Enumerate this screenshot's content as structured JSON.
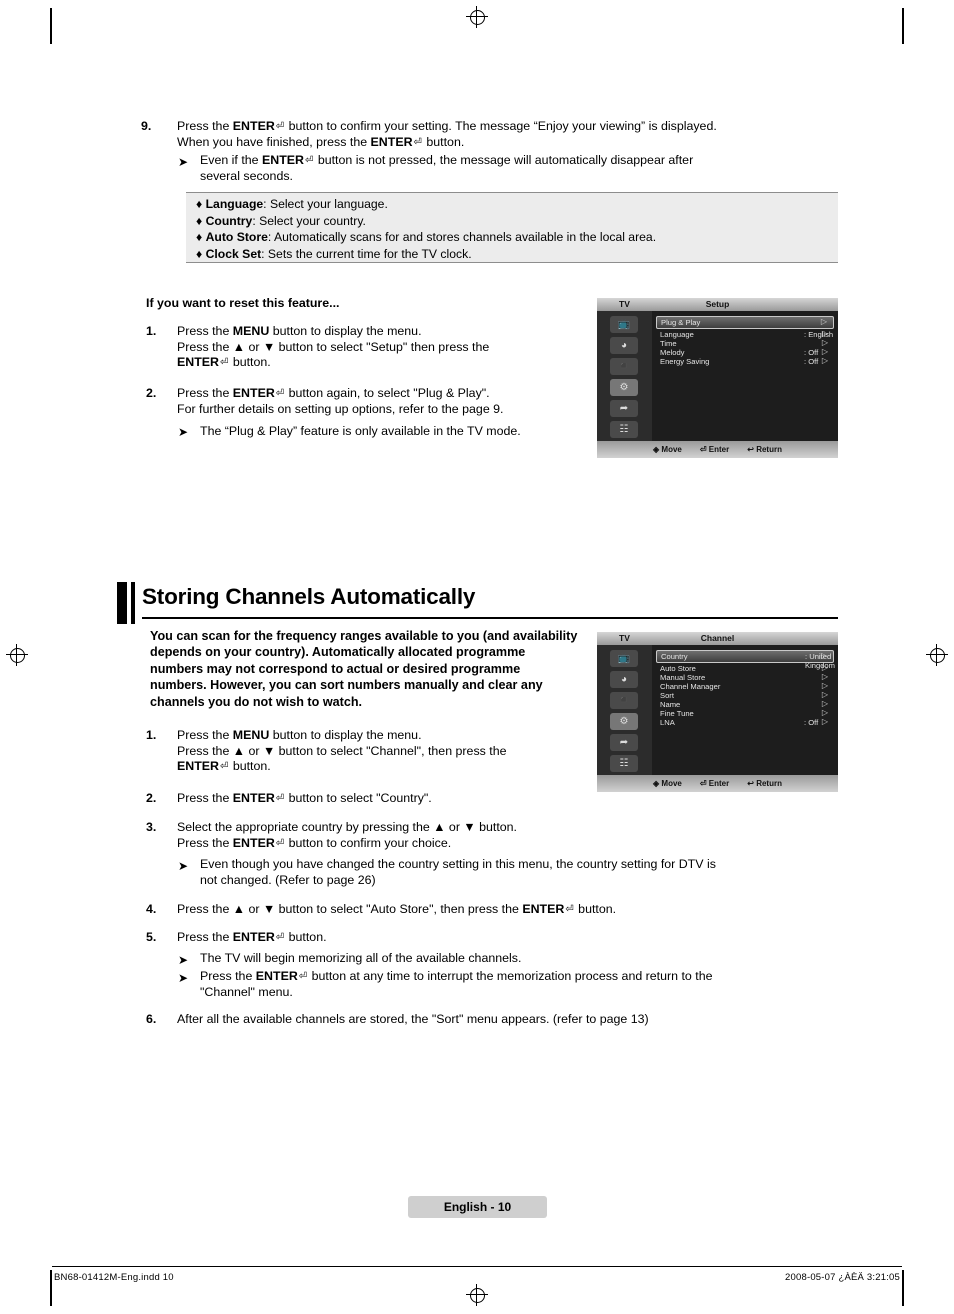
{
  "steps": {
    "s9": {
      "num": "9.",
      "line1_pre": "Press the ",
      "line1_b1": "ENTER",
      "line1_mid": " button to confirm your setting. The message “Enjoy your viewing” is displayed.",
      "line2_pre": "When you have finished, press the ",
      "line2_b1": "ENTER",
      "line2_post": " button.",
      "sub_pre": "Even if the ",
      "sub_b1": "ENTER",
      "sub_post": " button is not pressed, the message will automatically disappear after",
      "sub_line2": "several seconds."
    }
  },
  "notebox": [
    {
      "bullet": "♦",
      "term": "Language",
      "text": ": Select your language."
    },
    {
      "bullet": "♦",
      "term": "Country",
      "text": ": Select your country."
    },
    {
      "bullet": "♦",
      "term": "Auto Store",
      "text": ": Automatically scans for and stores channels available in the local area."
    },
    {
      "bullet": "♦",
      "term": "Clock Set",
      "text": ": Sets the current time for the TV clock."
    }
  ],
  "reset": {
    "heading": "If you want to reset this feature...",
    "s1": {
      "num": "1.",
      "l1_a": "Press the ",
      "l1_b": "MENU",
      "l1_c": " button to display the menu.",
      "l2_a": "Press the ▲ or ▼ button to select \"Setup\" then press the",
      "l3_b": "ENTER",
      "l3_c": " button."
    },
    "s2": {
      "num": "2.",
      "l1_a": "Press the ",
      "l1_b": "ENTER",
      "l1_c": " button again, to select \"Plug & Play\".",
      "l2": "For further details on setting up options, refer to the page 9.",
      "sub": "The “Plug & Play” feature is only available in the TV mode."
    }
  },
  "section": {
    "title": "Storing Channels Automatically",
    "intro": "You can scan for the frequency ranges available to you (and availability depends on your country). Automatically allocated programme numbers may not correspond to actual or desired programme numbers. However, you can sort numbers manually and clear any channels you do not wish to watch."
  },
  "channel_steps": {
    "s1": {
      "num": "1.",
      "l1_a": "Press the ",
      "l1_b": "MENU",
      "l1_c": " button to display the menu.",
      "l2": "Press the ▲ or ▼ button to select \"Channel\", then press the",
      "l3_b": "ENTER",
      "l3_c": " button."
    },
    "s2": {
      "num": "2.",
      "l1_a": "Press the ",
      "l1_b": "ENTER",
      "l1_c": " button to select \"Country\"."
    },
    "s3": {
      "num": "3.",
      "l1": "Select the appropriate country by pressing the ▲ or ▼ button.",
      "l2_a": "Press the ",
      "l2_b": "ENTER",
      "l2_c": " button to confirm your choice.",
      "sub1": "Even though you have changed the country setting in this menu, the country setting for DTV is",
      "sub2": "not changed. (Refer to page 26)"
    },
    "s4": {
      "num": "4.",
      "l1_a": "Press the ▲ or ▼ button to select \"Auto Store\", then press the ",
      "l1_b": "ENTER",
      "l1_c": " button."
    },
    "s5": {
      "num": "5.",
      "l1_a": "Press the ",
      "l1_b": "ENTER",
      "l1_c": " button.",
      "sub1": "The TV will begin memorizing all of the available channels.",
      "sub2_a": "Press the ",
      "sub2_b": "ENTER",
      "sub2_c": " button at any time to interrupt the memorization process and return to the",
      "sub3": "\"Channel\" menu."
    },
    "s6": {
      "num": "6.",
      "l1": "After all the available channels are stored, the \"Sort\" menu appears. (refer to page 13)"
    }
  },
  "osd_setup": {
    "tv": "TV",
    "title": "Setup",
    "rows": [
      {
        "label": "Plug & Play",
        "value": "",
        "arrow": "▷",
        "highlight": true
      },
      {
        "label": "Language",
        "value": ": English",
        "arrow": "▷",
        "highlight": false
      },
      {
        "label": "Time",
        "value": "",
        "arrow": "▷",
        "highlight": false
      },
      {
        "label": "Melody",
        "value": ": Off",
        "arrow": "▷",
        "highlight": false
      },
      {
        "label": "Energy Saving",
        "value": ": Off",
        "arrow": "▷",
        "highlight": false
      }
    ],
    "footer": {
      "move": "Move",
      "enter": "Enter",
      "return": "Return"
    },
    "icons": [
      "picture-icon",
      "sound-icon",
      "channel-icon",
      "setup-icon",
      "input-icon",
      "support-icon"
    ]
  },
  "osd_channel": {
    "tv": "TV",
    "title": "Channel",
    "rows": [
      {
        "label": "Country",
        "value": ": United Kingdom",
        "arrow": "▷",
        "highlight": true
      },
      {
        "label": "Auto Store",
        "value": "",
        "arrow": "▷",
        "highlight": false
      },
      {
        "label": "Manual Store",
        "value": "",
        "arrow": "▷",
        "highlight": false
      },
      {
        "label": "Channel Manager",
        "value": "",
        "arrow": "▷",
        "highlight": false
      },
      {
        "label": "Sort",
        "value": "",
        "arrow": "▷",
        "highlight": false
      },
      {
        "label": "Name",
        "value": "",
        "arrow": "▷",
        "highlight": false
      },
      {
        "label": "Fine Tune",
        "value": "",
        "arrow": "▷",
        "highlight": false
      },
      {
        "label": "LNA",
        "value": ": Off",
        "arrow": "▷",
        "highlight": false
      }
    ],
    "footer": {
      "move": "Move",
      "enter": "Enter",
      "return": "Return"
    },
    "icons": [
      "picture-icon",
      "sound-icon",
      "channel-icon",
      "setup-icon",
      "input-icon",
      "support-icon"
    ]
  },
  "page_badge": "English - 10",
  "footer": {
    "left": "BN68-01412M-Eng.indd   10",
    "right": "2008-05-07   ¿ÀÈÄ 3:21:05"
  }
}
